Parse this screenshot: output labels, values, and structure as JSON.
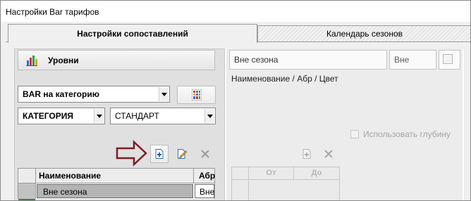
{
  "window": {
    "title": "Настройки Bar тарифов"
  },
  "tabs": [
    {
      "label": "Настройки сопоставлений",
      "active": true
    },
    {
      "label": "Календарь сезонов",
      "active": false
    }
  ],
  "left_panel": {
    "levels_button": {
      "label": "Уровни",
      "icon": "bar-chart-icon"
    },
    "bar_mode_select": {
      "value": "BAR на категорию"
    },
    "category_type_select": {
      "value": "КАТЕГОРИЯ"
    },
    "category_select": {
      "value": "СТАНДАРТ"
    },
    "color_grid_button": {
      "icon": "color-grid-icon"
    },
    "toolbar": [
      {
        "name": "add",
        "icon": "add-document-icon",
        "enabled": true
      },
      {
        "name": "edit",
        "icon": "edit-document-icon",
        "enabled": true
      },
      {
        "name": "delete",
        "icon": "close-icon",
        "enabled": false
      }
    ],
    "table": {
      "columns": [
        "Наименование",
        "Абр"
      ],
      "rows": [
        {
          "name": "Вне сезона",
          "abbr": "Вне",
          "selected": true
        }
      ]
    }
  },
  "right_panel": {
    "name_field": {
      "value": "Вне сезона"
    },
    "abbr_field": {
      "value": "Вне"
    },
    "fields_caption": "Наименование / Абр / Цвет",
    "use_depth": {
      "label": "Использовать глубину",
      "checked": false,
      "enabled": false
    },
    "toolbar": [
      {
        "name": "add",
        "icon": "add-document-icon",
        "enabled": false
      },
      {
        "name": "delete",
        "icon": "close-icon",
        "enabled": false
      }
    ],
    "table": {
      "columns": [
        "От",
        "До"
      ]
    }
  },
  "colors": {
    "annotation_arrow": "#7a1f24",
    "selected_row": "#b4b4b4",
    "accent_green": "#2a8c3c"
  }
}
